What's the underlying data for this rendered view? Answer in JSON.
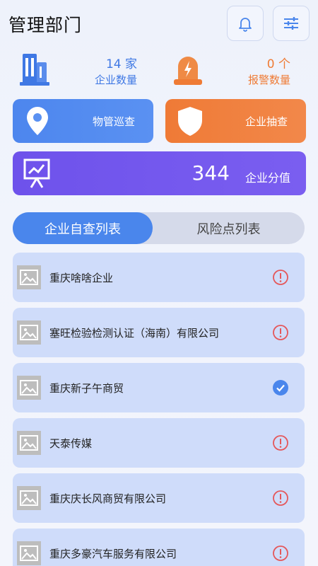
{
  "header": {
    "title": "管理部门",
    "icons": {
      "bell": "bell-icon",
      "filter": "filter-sliders-icon"
    }
  },
  "stats": {
    "enterprise": {
      "value": "14",
      "unit": "家",
      "label": "企业数量",
      "color": "#3f78e4",
      "icon": "building-icon"
    },
    "alarm": {
      "value": "0",
      "unit": "个",
      "label": "报警数量",
      "color": "#ef7b35",
      "icon": "alarm-light-icon"
    }
  },
  "actions": {
    "patrol": {
      "label": "物管巡查",
      "icon": "location-pin-icon",
      "color": "#4d86ee"
    },
    "spot_check": {
      "label": "企业抽查",
      "icon": "shield-icon",
      "color": "#ef7a36"
    }
  },
  "score": {
    "value": "344",
    "label": "企业分值",
    "icon": "presentation-chart-icon",
    "color": "#6e52eb"
  },
  "tabs": [
    {
      "label": "企业自查列表",
      "active": true
    },
    {
      "label": "风险点列表",
      "active": false
    }
  ],
  "list": [
    {
      "name": "重庆啥啥企业",
      "status": "warning"
    },
    {
      "name": "塞旺检验检测认证（海南）有限公司",
      "status": "warning"
    },
    {
      "name": "重庆新子午商贸",
      "status": "done"
    },
    {
      "name": "天泰传媒",
      "status": "warning"
    },
    {
      "name": "重庆庆长风商贸有限公司",
      "status": "warning"
    },
    {
      "name": "重庆多豪汽车服务有限公司",
      "status": "warning"
    }
  ],
  "colors": {
    "warning": "#e5575a",
    "done": "#4a86ec",
    "list_bg": "#cfdcfa"
  }
}
